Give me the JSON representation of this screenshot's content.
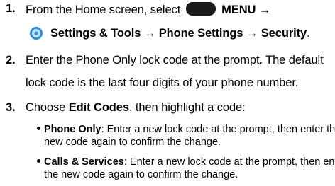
{
  "steps": [
    {
      "number": "1.",
      "line1_pre": "From the Home screen, select",
      "menu_label": "MENU →",
      "line2": "Settings & Tools → Phone Settings → Security",
      "line2_end": "."
    },
    {
      "number": "2.",
      "line1": "Enter the Phone Only lock code at the prompt. The default",
      "line2": "lock code is the last four digits of your phone number."
    },
    {
      "number": "3.",
      "line1_pre": "Choose ",
      "line1_bold": "Edit Codes",
      "line1_post": ", then highlight a code:",
      "bullets": [
        {
          "term": "Phone Only",
          "line1": ": Enter a new lock code at the prompt, then enter the",
          "line2": "new code again to confirm the change."
        },
        {
          "term": "Calls & Services",
          "line1": ": Enter a new lock code at the prompt, then enter",
          "line2": "the new code again to confirm the change."
        }
      ]
    }
  ],
  "icons": {
    "menu_key": "menu-key-icon",
    "settings": "settings-tools-icon"
  },
  "colors": {
    "text": "#000000",
    "menu_key": "#1a1a1a",
    "settings_icon_blue": "#2f8fd8"
  }
}
